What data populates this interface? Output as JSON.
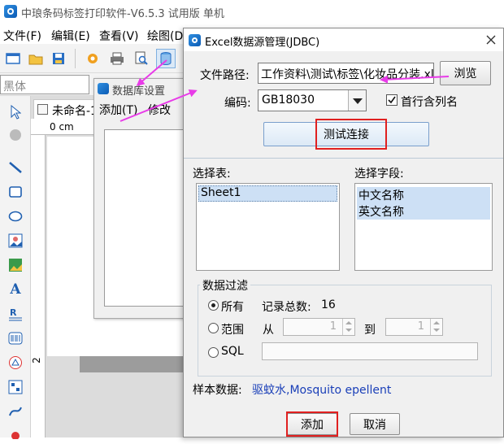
{
  "app": {
    "title": "中琅条码标签打印软件-V6.5.3 试用版 单机",
    "menu": [
      "文件(F)",
      "编辑(E)",
      "查看(V)",
      "绘图(D"
    ],
    "font_name": "黑体",
    "doc_tab": "未命名-1",
    "ruler_label": "0 cm",
    "ruler_v_label": "2"
  },
  "db_settings": {
    "title": "数据库设置",
    "add": "添加(T)",
    "edit": "修改"
  },
  "dialog": {
    "title": "Excel数据源管理(JDBC)",
    "path_label": "文件路径:",
    "path_value": "工作资料\\测试\\标签\\化妆品分装.xlsx",
    "browse": "浏览",
    "encoding_label": "编码:",
    "encoding_value": "GB18030",
    "header_row_label": "首行含列名",
    "header_row_checked": true,
    "test_connection": "测试连接",
    "select_table_label": "选择表:",
    "tables": [
      "Sheet1"
    ],
    "select_field_label": "选择字段:",
    "fields": [
      "中文名称",
      "英文名称"
    ],
    "filter": {
      "title": "数据过滤",
      "all": "所有",
      "record_total_label": "记录总数:",
      "record_total": "16",
      "range": "范围",
      "from": "从",
      "from_value": "1",
      "to": "到",
      "to_value": "1",
      "sql": "SQL"
    },
    "sample_label": "样本数据:",
    "sample_value": "驱蚊水,Mosquito epellent",
    "add": "添加",
    "cancel": "取消"
  },
  "colors": {
    "annotation_arrow": "#e83be8",
    "highlight_box": "#e02020",
    "selection": "#cde0f5",
    "sample_text": "#1a3fb8"
  }
}
